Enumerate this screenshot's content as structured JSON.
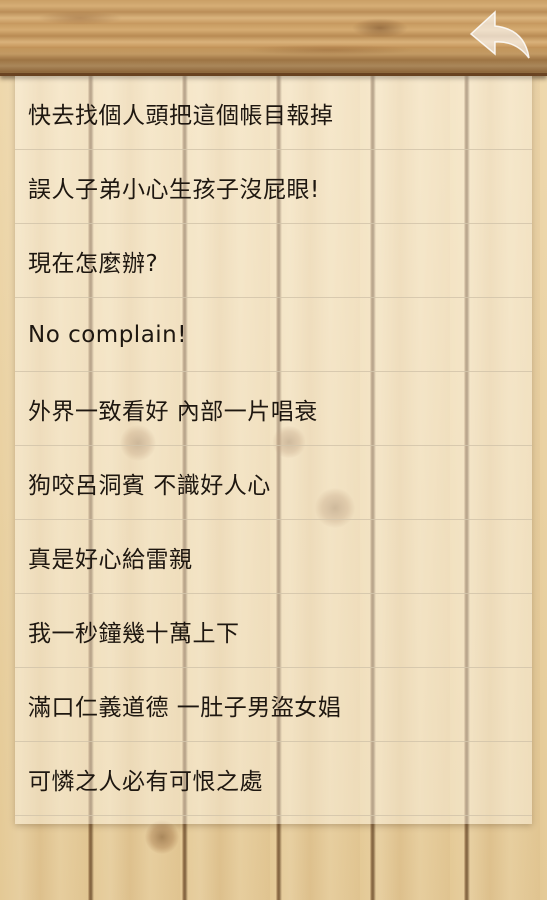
{
  "header": {
    "back_icon": "back-arrow-icon"
  },
  "list": {
    "items": [
      {
        "text": "快去找個人頭把這個帳目報掉"
      },
      {
        "text": "誤人子弟小心生孩子沒屁眼!"
      },
      {
        "text": "現在怎麼辦?"
      },
      {
        "text": "No complain!"
      },
      {
        "text": "外界一致看好 內部一片唱衰"
      },
      {
        "text": "狗咬呂洞賓 不識好人心"
      },
      {
        "text": "真是好心給雷親"
      },
      {
        "text": "我一秒鐘幾十萬上下"
      },
      {
        "text": "滿口仁義道德 一肚子男盜女娼"
      },
      {
        "text": "可憐之人必有可恨之處"
      }
    ]
  },
  "colors": {
    "wood_bar": "#c9a066",
    "wood_background": "#e9d2a6",
    "text": "#1e1710",
    "divider": "#d2c4aa"
  }
}
